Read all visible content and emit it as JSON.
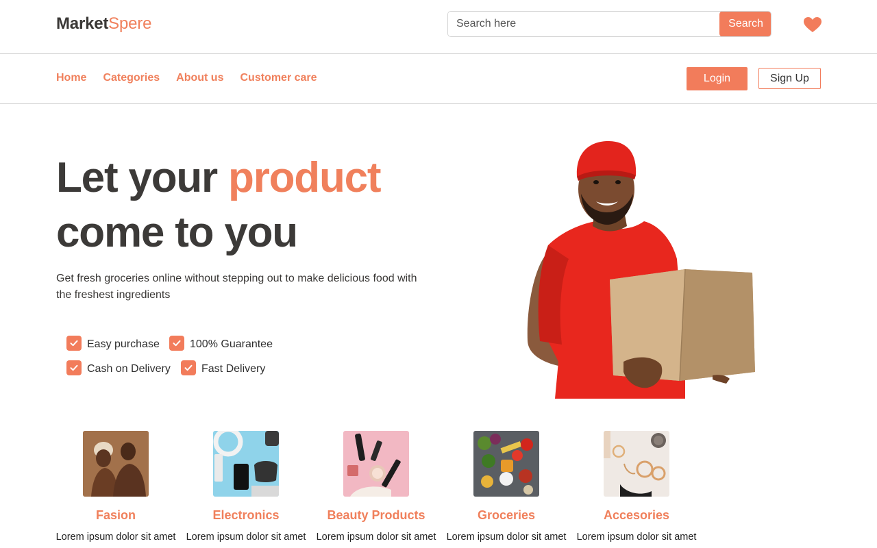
{
  "header": {
    "logo_part1": "Market",
    "logo_part2": "Spere",
    "search_placeholder": "Search here",
    "search_button": "Search",
    "favorites_icon": "heart-icon"
  },
  "nav": {
    "links": [
      "Home",
      "Categories",
      "About us",
      "Customer care"
    ],
    "login": "Login",
    "signup": "Sign Up"
  },
  "hero": {
    "title_part1": "Let your ",
    "title_accent": "product",
    "title_part2": "come to you",
    "subtitle": "Get fresh groceries online without stepping out to make delicious food with the freshest ingredients",
    "features": [
      "Easy purchase",
      "100% Guarantee",
      "Cash on Delivery",
      "Fast Delivery"
    ],
    "image": "delivery-man-holding-box"
  },
  "categories": [
    {
      "name": "Fasion",
      "desc": "Lorem ipsum dolor sit amet",
      "image": "fashion-couple-photo"
    },
    {
      "name": "Electronics",
      "desc": "Lorem ipsum dolor sit amet",
      "image": "electronics-flatlay-photo"
    },
    {
      "name": "Beauty Products",
      "desc": "Lorem ipsum dolor sit amet",
      "image": "cosmetics-flatlay-photo"
    },
    {
      "name": "Groceries",
      "desc": "Lorem ipsum dolor sit amet",
      "image": "groceries-vegetables-photo"
    },
    {
      "name": "Accesories",
      "desc": "Lorem ipsum dolor sit amet",
      "image": "jewelry-accessories-photo"
    }
  ],
  "colors": {
    "accent": "#f27c5b",
    "text_dark": "#3c3a38",
    "border": "#cfcfcf"
  }
}
